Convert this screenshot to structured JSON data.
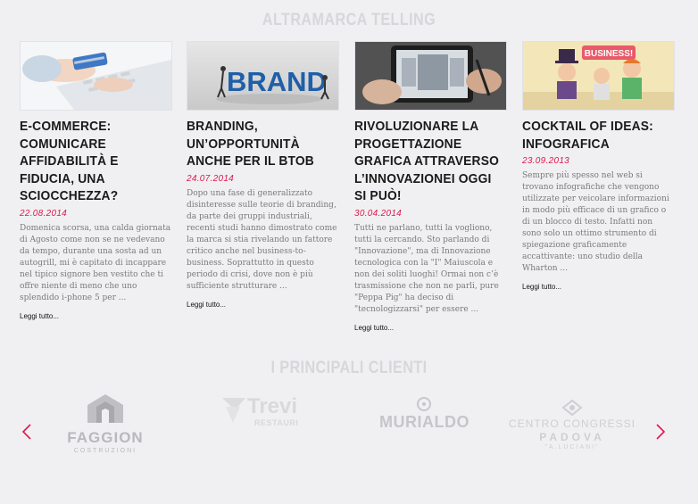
{
  "blog": {
    "title": "ALTRAMARCA TELLING",
    "posts": [
      {
        "title": "E-COMMERCE: COMUNICARE AFFIDABILITÀ E FIDUCIA, UNA SCIOCCHEZZA?",
        "date": "22.08.2014",
        "excerpt": "Domenica scorsa, una calda giornata di Agosto come non se ne vedevano da tempo, durante una sosta ad un autogrill, mi è capitato di incappare nel tipico signore ben vestito che ti offre niente di meno che uno splendido i-phone 5 per ...",
        "read_more": "Leggi tutto..."
      },
      {
        "title": "BRANDING, UN’OPPORTUNITÀ ANCHE PER IL BTOB",
        "date": "24.07.2014",
        "excerpt": "Dopo una fase di generalizzato disinteresse sulle teorie di branding, da parte dei gruppi industriali, recenti studi hanno dimostrato come la marca si stia rivelando un fattore critico anche nel business-to-business. Soprattutto in questo periodo di crisi, dove non è più sufficiente strutturare ...",
        "read_more": "Leggi tutto...",
        "image_text": "BRAND"
      },
      {
        "title": "RIVOLUZIONARE LA PROGETTAZIONE GRAFICA ATTRAVERSO L’INNOVAZIONEI OGGI SI PUÒ!",
        "date": "30.04.2014",
        "excerpt": "Tutti ne parlano, tutti la vogliono, tutti la cercando. Sto parlando di \"Innovazione\", ma di Innovazione tecnologica con la \"I\" Maiuscola e non dei soliti luoghi! Ormai non c’è trasmissione che non ne parli, pure \"Peppa Pig\" ha deciso di \"tecnologizzarsi\" per essere ...",
        "read_more": "Leggi tutto..."
      },
      {
        "title": "COCKTAIL OF IDEAS: INFOGRAFICA",
        "date": "23.09.2013",
        "excerpt": "Sempre più spesso nel web si trovano infografiche che vengono utilizzate per veicolare informazioni in modo più efficace di un grafico o di un blocco di testo. Infatti non sono solo un ottimo strumento di spiegazione graficamente accattivante: uno studio della Wharton ...",
        "read_more": "Leggi tutto...",
        "image_text": "BUSINESS!"
      }
    ]
  },
  "clients": {
    "title": "I PRINCIPALI CLIENTI",
    "logos": [
      {
        "name": "FAGGION",
        "sub": "COSTRUZIONI"
      },
      {
        "name": "Trevi",
        "sub": "RESTAURI"
      },
      {
        "name": "MURIALDO"
      },
      {
        "line1": "CENTRO CONGRESSI",
        "line2": "PADOVA",
        "line3": "\"A.LUCIANI\""
      }
    ]
  },
  "colors": {
    "accent": "#e0174d",
    "title_gray": "#d7d7db",
    "logo_gray": "#b9b9bd"
  },
  "icons": {
    "prev": "chevron-left-icon",
    "next": "chevron-right-icon"
  }
}
